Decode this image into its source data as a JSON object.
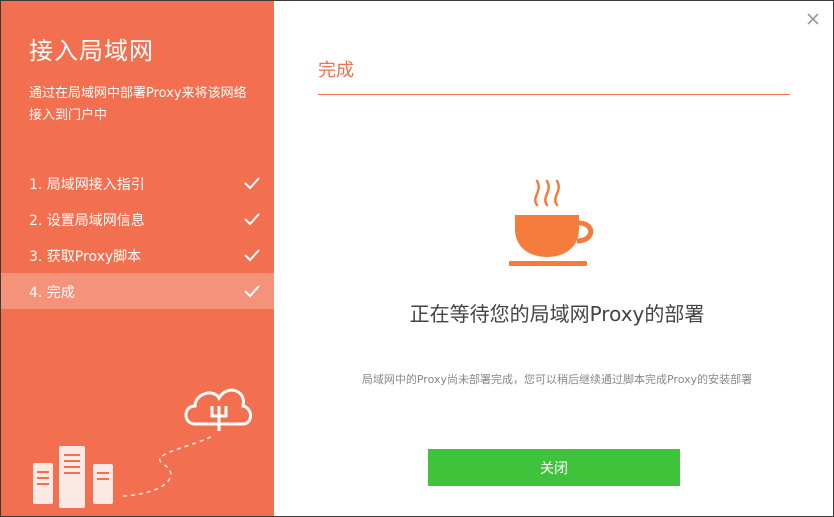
{
  "sidebar": {
    "title": "接入局域网",
    "description": "通过在局域网中部署Proxy来将该网络接入到门户中",
    "steps": [
      {
        "label": "1. 局域网接入指引",
        "done": true,
        "active": false
      },
      {
        "label": "2. 设置局域网信息",
        "done": true,
        "active": false
      },
      {
        "label": "3. 获取Proxy脚本",
        "done": true,
        "active": false
      },
      {
        "label": "4. 完成",
        "done": true,
        "active": true
      }
    ]
  },
  "main": {
    "title": "完成",
    "status": "正在等待您的局域网Proxy的部署",
    "hint": "局域网中的Proxy尚未部署完成，您可以稍后继续通过脚本完成Proxy的安装部署",
    "close_button_label": "关闭"
  },
  "colors": {
    "accent": "#f26f4f",
    "sidebar_active": "#f4927a",
    "cup": "#f57c3c",
    "button": "#3fc33b"
  },
  "icons": {
    "close": "close-icon",
    "check": "check-icon",
    "cup": "coffee-cup-icon",
    "cloud": "cloud-upload-icon",
    "servers": "server-icon"
  }
}
